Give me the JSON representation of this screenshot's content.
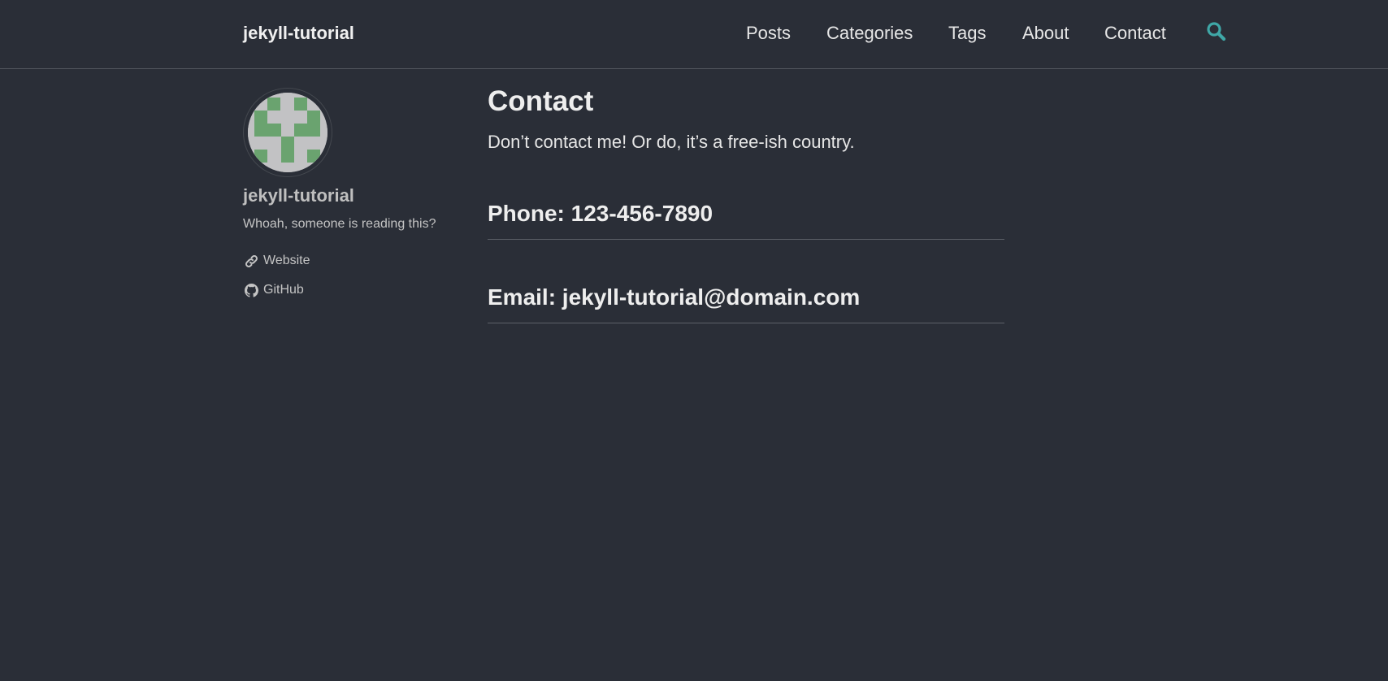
{
  "header": {
    "site_title": "jekyll-tutorial",
    "nav": [
      {
        "label": "Posts"
      },
      {
        "label": "Categories"
      },
      {
        "label": "Tags"
      },
      {
        "label": "About"
      },
      {
        "label": "Contact"
      }
    ],
    "search_icon": "search-icon",
    "accent_color": "#3fa7a7"
  },
  "sidebar": {
    "author_name": "jekyll-tutorial",
    "bio": "Whoah, someone is reading this?",
    "links": [
      {
        "label": "Website",
        "icon": "link-icon"
      },
      {
        "label": "GitHub",
        "icon": "github-icon"
      }
    ],
    "avatar_colors": {
      "fill": "#6aa36f",
      "background": "#c2c2c4"
    }
  },
  "main": {
    "title": "Contact",
    "intro": "Don’t contact me! Or do, it’s a free-ish country.",
    "phone_heading": "Phone: 123-456-7890",
    "email_heading": "Email: jekyll-tutorial@domain.com"
  }
}
